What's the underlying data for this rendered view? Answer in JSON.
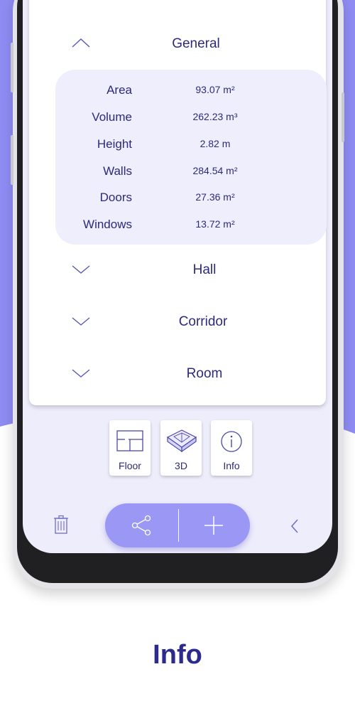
{
  "colors": {
    "accent": "#8f8df4",
    "text": "#2c2a7a",
    "panel": "#efeefc",
    "fab": "#9b98f5"
  },
  "sections": [
    {
      "title": "General",
      "expanded": true,
      "icon": "chevron-up-icon"
    },
    {
      "title": "Hall",
      "expanded": false,
      "icon": "chevron-down-icon"
    },
    {
      "title": "Corridor",
      "expanded": false,
      "icon": "chevron-down-icon"
    },
    {
      "title": "Room",
      "expanded": false,
      "icon": "chevron-down-icon"
    }
  ],
  "stats": [
    {
      "label": "Area",
      "value": "93.07 m²"
    },
    {
      "label": "Volume",
      "value": "262.23 m³"
    },
    {
      "label": "Height",
      "value": "2.82 m"
    },
    {
      "label": "Walls",
      "value": "284.54 m²"
    },
    {
      "label": "Doors",
      "value": "27.36 m²"
    },
    {
      "label": "Windows",
      "value": "13.72 m²"
    }
  ],
  "view_modes": [
    {
      "label": "Floor",
      "icon": "floor-plan-icon"
    },
    {
      "label": "3D",
      "icon": "3d-room-icon"
    },
    {
      "label": "Info",
      "icon": "info-icon",
      "selected": true
    }
  ],
  "toolbar": {
    "delete_icon": "trash-icon",
    "share_icon": "share-icon",
    "add_icon": "plus-icon",
    "back_icon": "chevron-left-icon"
  },
  "caption": "Info"
}
